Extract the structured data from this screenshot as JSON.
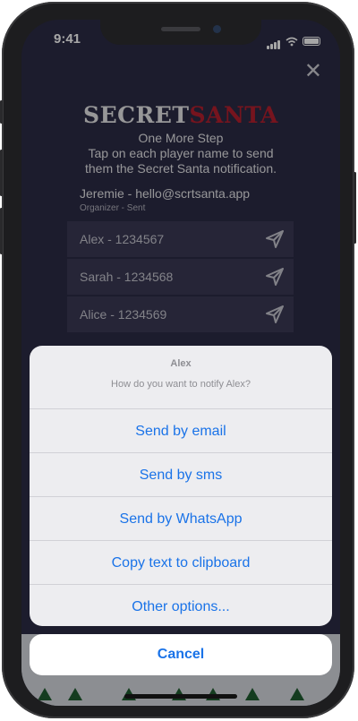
{
  "status_bar": {
    "time": "9:41"
  },
  "header": {
    "logo_part1": "SECRET",
    "logo_part2": "SANTA",
    "close_label": "✕"
  },
  "intro": {
    "line1": "One More Step",
    "line2": "Tap on each player name to send",
    "line3": "them the Secret Santa notification."
  },
  "organizer": {
    "label": "Jeremie - hello@scrtsanta.app",
    "status": "Organizer - Sent"
  },
  "players": [
    {
      "label": "Alex - 1234567"
    },
    {
      "label": "Sarah - 1234568"
    },
    {
      "label": "Alice - 1234569"
    }
  ],
  "action_sheet": {
    "title": "Alex",
    "message": "How do you want to notify Alex?",
    "options": [
      {
        "label": "Send by email"
      },
      {
        "label": "Send by sms"
      },
      {
        "label": "Send by WhatsApp"
      },
      {
        "label": "Copy text to clipboard"
      },
      {
        "label": "Other options..."
      }
    ],
    "cancel_label": "Cancel"
  },
  "colors": {
    "background": "#2c2b45",
    "accent_red": "#b5202e",
    "action_blue": "#1a73e8"
  }
}
